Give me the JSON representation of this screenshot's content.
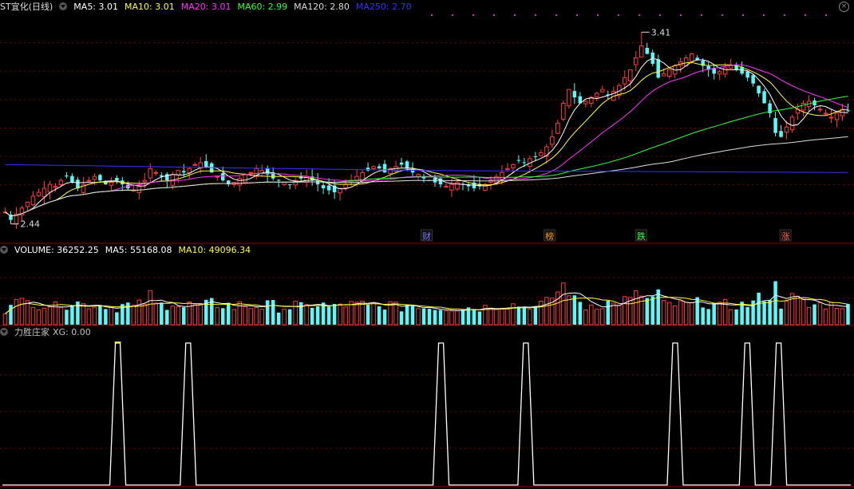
{
  "main": {
    "title": "ST宜化(日线)",
    "ma": [
      {
        "label": "MA5: 3.01",
        "color": "#ffffff"
      },
      {
        "label": "MA10: 3.01",
        "color": "#ffff33"
      },
      {
        "label": "MA20: 3.01",
        "color": "#ff33ff"
      },
      {
        "label": "MA60: 2.99",
        "color": "#33ff33"
      },
      {
        "label": "MA120: 2.80",
        "color": "#dddddd"
      },
      {
        "label": "MA250: 2.70",
        "color": "#3333ff"
      }
    ],
    "high_label": "3.41",
    "low_label": "2.44",
    "markers": [
      {
        "text": "财",
        "color": "#7777ff",
        "pos": 0.5
      },
      {
        "text": "榜",
        "color": "#ff9900",
        "pos": 0.645
      },
      {
        "text": "跌",
        "color": "#33ff33",
        "pos": 0.753
      },
      {
        "text": "涨",
        "color": "#ff5555",
        "pos": 0.923
      }
    ]
  },
  "volume": {
    "labels": [
      {
        "label": "VOLUME: 36252.25",
        "color": "#ffffff"
      },
      {
        "label": "MA5: 55168.08",
        "color": "#ffffff"
      },
      {
        "label": "MA10: 49096.34",
        "color": "#ffff33"
      }
    ]
  },
  "indicator": {
    "name": "力胜庄家",
    "value": "XG: 0.00",
    "signal_positions": [
      0.136,
      0.219,
      0.517,
      0.617,
      0.793,
      0.878,
      0.915
    ]
  },
  "chart_data": {
    "type": "candlestick",
    "price_range": [
      2.35,
      3.5
    ],
    "price_high": 3.41,
    "price_low": 2.44,
    "last_close": 3.01,
    "ma_last": {
      "MA5": 3.01,
      "MA10": 3.01,
      "MA20": 3.01,
      "MA60": 2.99,
      "MA120": 2.8,
      "MA250": 2.7
    },
    "closes": [
      2.5,
      2.46,
      2.49,
      2.52,
      2.55,
      2.58,
      2.6,
      2.62,
      2.64,
      2.63,
      2.66,
      2.68,
      2.65,
      2.62,
      2.64,
      2.66,
      2.68,
      2.66,
      2.64,
      2.65,
      2.66,
      2.64,
      2.62,
      2.61,
      2.63,
      2.66,
      2.72,
      2.7,
      2.68,
      2.66,
      2.69,
      2.71,
      2.7,
      2.72,
      2.74,
      2.75,
      2.73,
      2.7,
      2.68,
      2.66,
      2.64,
      2.65,
      2.67,
      2.69,
      2.7,
      2.72,
      2.71,
      2.69,
      2.67,
      2.66,
      2.65,
      2.64,
      2.66,
      2.67,
      2.68,
      2.66,
      2.64,
      2.62,
      2.61,
      2.6,
      2.62,
      2.64,
      2.66,
      2.68,
      2.7,
      2.71,
      2.73,
      2.72,
      2.7,
      2.72,
      2.73,
      2.74,
      2.72,
      2.7,
      2.69,
      2.67,
      2.66,
      2.65,
      2.64,
      2.63,
      2.64,
      2.65,
      2.64,
      2.63,
      2.62,
      2.63,
      2.64,
      2.66,
      2.68,
      2.7,
      2.72,
      2.74,
      2.76,
      2.75,
      2.77,
      2.78,
      2.8,
      2.83,
      2.88,
      2.95,
      3.05,
      3.12,
      3.08,
      3.05,
      3.06,
      3.08,
      3.1,
      3.12,
      3.09,
      3.11,
      3.14,
      3.18,
      3.22,
      3.28,
      3.34,
      3.3,
      3.25,
      3.18,
      3.2,
      3.22,
      3.24,
      3.26,
      3.28,
      3.3,
      3.27,
      3.24,
      3.22,
      3.2,
      3.21,
      3.23,
      3.24,
      3.22,
      3.2,
      3.18,
      3.15,
      3.1,
      3.05,
      3.0,
      2.9,
      2.88,
      2.93,
      2.98,
      3.02,
      3.05,
      3.06,
      3.04,
      3.02,
      3.0,
      2.98,
      3.0,
      3.02,
      3.01
    ]
  }
}
